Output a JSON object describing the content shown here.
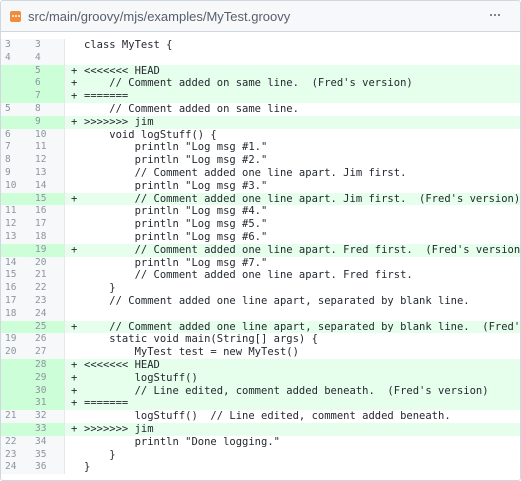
{
  "file": {
    "path": "src/main/groovy/mjs/examples/MyTest.groovy",
    "icon": "groovy-file-icon",
    "menu_icon": "more-icon",
    "accent": "#f08c3c"
  },
  "colors": {
    "added_bg": "#e6ffec",
    "added_gutter": "#ccffd8",
    "gutter_bg": "#f6f8fa"
  },
  "lines": [
    {
      "old": "3",
      "new": "3",
      "m": "",
      "text": "class MyTest {",
      "added": false
    },
    {
      "old": "4",
      "new": "4",
      "m": "",
      "text": "",
      "added": false
    },
    {
      "old": "",
      "new": "5",
      "m": "+",
      "text": "<<<<<<< HEAD",
      "added": true
    },
    {
      "old": "",
      "new": "6",
      "m": "+",
      "text": "    // Comment added on same line.  (Fred's version)",
      "added": true
    },
    {
      "old": "",
      "new": "7",
      "m": "+",
      "text": "=======",
      "added": true
    },
    {
      "old": "5",
      "new": "8",
      "m": "",
      "text": "    // Comment added on same line.",
      "added": false
    },
    {
      "old": "",
      "new": "9",
      "m": "+",
      "text": ">>>>>>> jim",
      "added": true
    },
    {
      "old": "6",
      "new": "10",
      "m": "",
      "text": "    void logStuff() {",
      "added": false
    },
    {
      "old": "7",
      "new": "11",
      "m": "",
      "text": "        println \"Log msg #1.\"",
      "added": false
    },
    {
      "old": "8",
      "new": "12",
      "m": "",
      "text": "        println \"Log msg #2.\"",
      "added": false
    },
    {
      "old": "9",
      "new": "13",
      "m": "",
      "text": "        // Comment added one line apart. Jim first.",
      "added": false
    },
    {
      "old": "10",
      "new": "14",
      "m": "",
      "text": "        println \"Log msg #3.\"",
      "added": false
    },
    {
      "old": "",
      "new": "15",
      "m": "+",
      "text": "        // Comment added one line apart. Jim first.  (Fred's version)",
      "added": true
    },
    {
      "old": "11",
      "new": "16",
      "m": "",
      "text": "        println \"Log msg #4.\"",
      "added": false
    },
    {
      "old": "12",
      "new": "17",
      "m": "",
      "text": "        println \"Log msg #5.\"",
      "added": false
    },
    {
      "old": "13",
      "new": "18",
      "m": "",
      "text": "        println \"Log msg #6.\"",
      "added": false
    },
    {
      "old": "",
      "new": "19",
      "m": "+",
      "text": "        // Comment added one line apart. Fred first.  (Fred's version)",
      "added": true
    },
    {
      "old": "14",
      "new": "20",
      "m": "",
      "text": "        println \"Log msg #7.\"",
      "added": false
    },
    {
      "old": "15",
      "new": "21",
      "m": "",
      "text": "        // Comment added one line apart. Fred first.",
      "added": false
    },
    {
      "old": "16",
      "new": "22",
      "m": "",
      "text": "    }",
      "added": false
    },
    {
      "old": "17",
      "new": "23",
      "m": "",
      "text": "    // Comment added one line apart, separated by blank line.",
      "added": false
    },
    {
      "old": "18",
      "new": "24",
      "m": "",
      "text": "",
      "added": false
    },
    {
      "old": "",
      "new": "25",
      "m": "+",
      "text": "    // Comment added one line apart, separated by blank line.  (Fred's ve",
      "added": true
    },
    {
      "old": "19",
      "new": "26",
      "m": "",
      "text": "    static void main(String[] args) {",
      "added": false
    },
    {
      "old": "20",
      "new": "27",
      "m": "",
      "text": "        MyTest test = new MyTest()",
      "added": false
    },
    {
      "old": "",
      "new": "28",
      "m": "+",
      "text": "<<<<<<< HEAD",
      "added": true
    },
    {
      "old": "",
      "new": "29",
      "m": "+",
      "text": "        logStuff()",
      "added": true
    },
    {
      "old": "",
      "new": "30",
      "m": "+",
      "text": "        // Line edited, comment added beneath.  (Fred's version)",
      "added": true
    },
    {
      "old": "",
      "new": "31",
      "m": "+",
      "text": "=======",
      "added": true
    },
    {
      "old": "21",
      "new": "32",
      "m": "",
      "text": "        logStuff()  // Line edited, comment added beneath.",
      "added": false
    },
    {
      "old": "",
      "new": "33",
      "m": "+",
      "text": ">>>>>>> jim",
      "added": true
    },
    {
      "old": "22",
      "new": "34",
      "m": "",
      "text": "        println \"Done logging.\"",
      "added": false
    },
    {
      "old": "23",
      "new": "35",
      "m": "",
      "text": "    }",
      "added": false
    },
    {
      "old": "24",
      "new": "36",
      "m": "",
      "text": "}",
      "added": false
    }
  ]
}
